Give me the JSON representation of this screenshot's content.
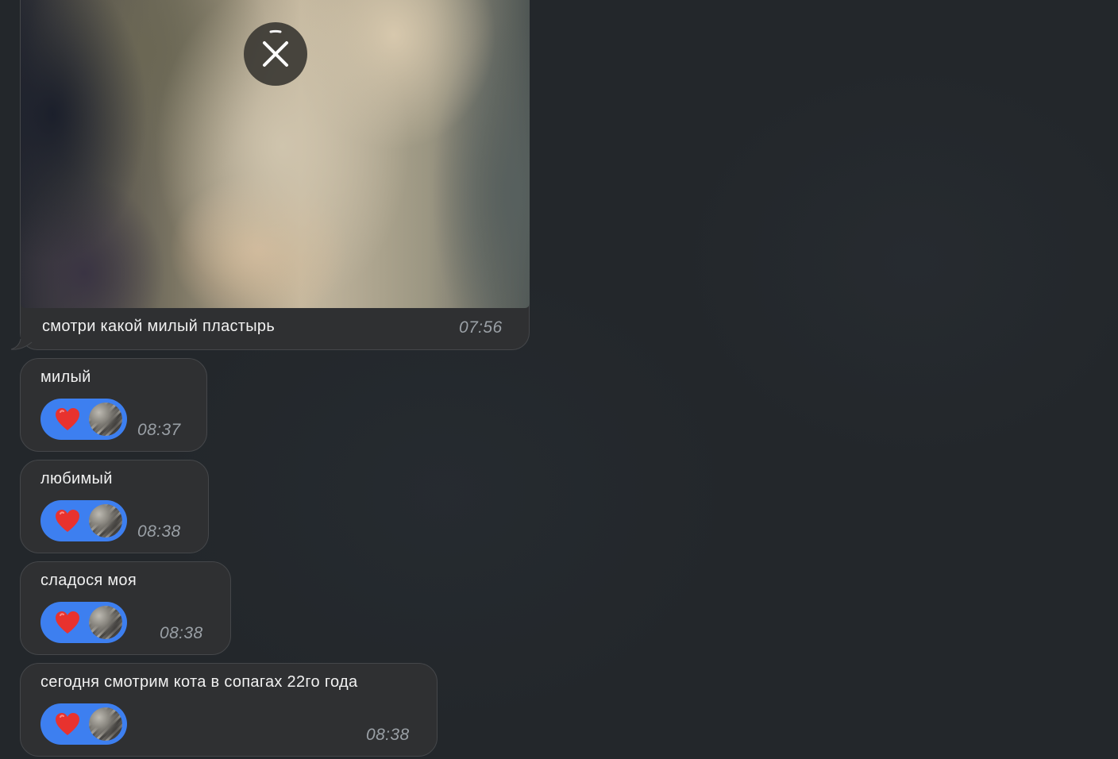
{
  "photo_message": {
    "caption": "смотри какой милый пластырь",
    "time": "07:56",
    "overlay_icon": "close-icon"
  },
  "messages": [
    {
      "text": "милый",
      "time": "08:37",
      "reaction": {
        "emoji": "heart",
        "icon": "heart-icon"
      }
    },
    {
      "text": "любимый",
      "time": "08:38",
      "reaction": {
        "emoji": "heart",
        "icon": "heart-icon"
      }
    },
    {
      "text": "сладося моя",
      "time": "08:38",
      "reaction": {
        "emoji": "heart",
        "icon": "heart-icon"
      }
    },
    {
      "text": "сегодня смотрим кота в сопагах 22го года",
      "time": "08:38",
      "reaction": {
        "emoji": "heart",
        "icon": "heart-icon"
      }
    }
  ],
  "colors": {
    "background": "#23272b",
    "bubble": "#2f3032",
    "reaction_pill": "#3d7ff0",
    "heart": "#e8322e",
    "timestamp": "#9aa0a6"
  }
}
